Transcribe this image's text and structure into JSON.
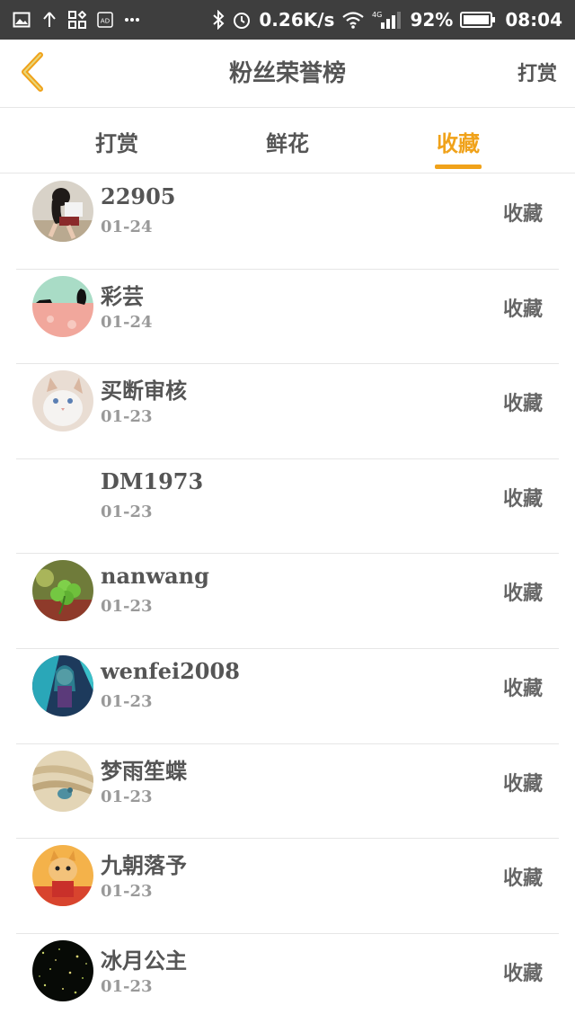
{
  "status_bar": {
    "speed": "0.26K/s",
    "network": "4G",
    "battery": "92%",
    "time": "08:04"
  },
  "header": {
    "title": "粉丝荣誉榜",
    "action_label": "打赏"
  },
  "tabs": [
    {
      "label": "打赏",
      "active": false
    },
    {
      "label": "鲜花",
      "active": false
    },
    {
      "label": "收藏",
      "active": true
    }
  ],
  "list": [
    {
      "name": "22905",
      "date": "01-24",
      "action": "收藏",
      "avatar": "girl-photo"
    },
    {
      "name": "彩芸",
      "date": "01-24",
      "action": "收藏",
      "avatar": "cats-pink-scene"
    },
    {
      "name": "买断审核",
      "date": "01-23",
      "action": "收藏",
      "avatar": "white-kitten"
    },
    {
      "name": "DM1973",
      "date": "01-23",
      "action": "收藏",
      "avatar": "none"
    },
    {
      "name": "nanwang",
      "date": "01-23",
      "action": "收藏",
      "avatar": "clover-leaf"
    },
    {
      "name": "wenfei2008",
      "date": "01-23",
      "action": "收藏",
      "avatar": "blue-anime"
    },
    {
      "name": "梦雨笙蝶",
      "date": "01-23",
      "action": "收藏",
      "avatar": "fabric-bird"
    },
    {
      "name": "九朝落予",
      "date": "01-23",
      "action": "收藏",
      "avatar": "orange-cat"
    },
    {
      "name": "冰月公主",
      "date": "01-23",
      "action": "收藏",
      "avatar": "dark-sparkles"
    }
  ],
  "colors": {
    "accent": "#f0a21a",
    "status_bar_bg": "#3e3e3e",
    "divider": "#e6e6e6"
  }
}
